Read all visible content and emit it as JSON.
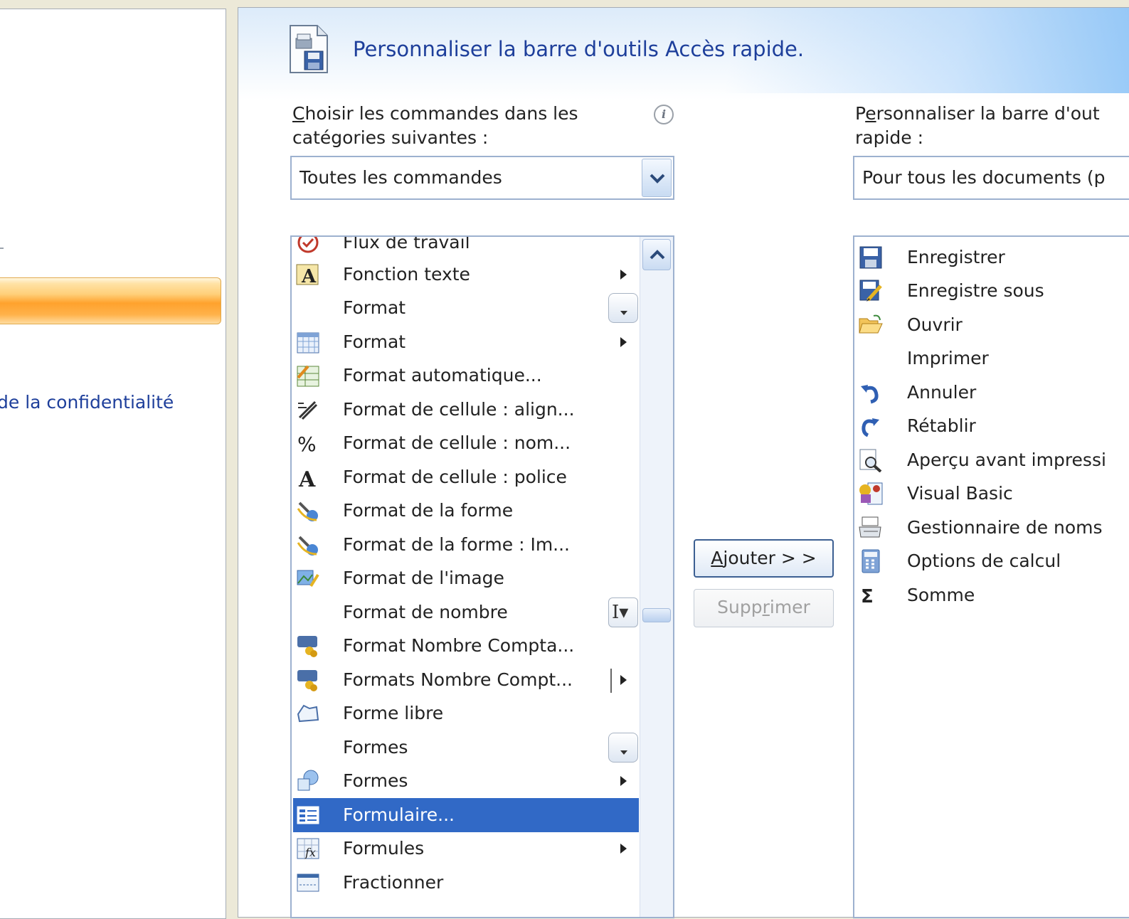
{
  "nav": {
    "privacy_link": "de la confidentialité"
  },
  "header": {
    "title": "Personnaliser la barre d'outils Accès rapide."
  },
  "commands": {
    "label_line1_first": "C",
    "label_line1_rest": "hoisir les commandes dans les",
    "label_line2": "catégories suivantes :",
    "selected": "Toutes les commandes",
    "items": [
      {
        "label": "Flux de travail",
        "icon": "workflow-icon"
      },
      {
        "label": "Fonction texte",
        "icon": "text-function-icon"
      },
      {
        "label": "Format",
        "icon": "none"
      },
      {
        "label": "Format",
        "icon": "calendar-format-icon"
      },
      {
        "label": "Format automatique...",
        "icon": "autoformat-icon"
      },
      {
        "label": "Format de cellule : align...",
        "icon": "align-icon"
      },
      {
        "label": "Format de cellule : nom...",
        "icon": "percent-icon"
      },
      {
        "label": "Format de cellule : police",
        "icon": "font-icon"
      },
      {
        "label": "Format de la forme",
        "icon": "shape-format-icon"
      },
      {
        "label": "Format de la forme : Im...",
        "icon": "shape-format-icon"
      },
      {
        "label": "Format de l'image",
        "icon": "picture-format-icon"
      },
      {
        "label": "Format de nombre",
        "icon": "none"
      },
      {
        "label": "Format Nombre Compta...",
        "icon": "accounting-icon"
      },
      {
        "label": "Formats Nombre Compt...",
        "icon": "accounting-icon"
      },
      {
        "label": "Forme libre",
        "icon": "freeform-icon"
      },
      {
        "label": "Formes",
        "icon": "none"
      },
      {
        "label": "Formes",
        "icon": "shapes-icon"
      },
      {
        "label": "Formulaire...",
        "icon": "form-icon"
      },
      {
        "label": "Formules",
        "icon": "formulas-icon"
      },
      {
        "label": "Fractionner",
        "icon": "split-icon"
      }
    ]
  },
  "buttons": {
    "add_first": "A",
    "add_rest": "jouter > >",
    "remove_before": "Supp",
    "remove_underlined": "r",
    "remove_after": "imer"
  },
  "toolbar": {
    "label_line1_first": "P",
    "label_line1_underlined": "e",
    "label_line1_rest": "rsonnaliser la barre d'out",
    "label_line2": "rapide :",
    "scope": "Pour tous les documents (p",
    "items": [
      {
        "label": "Enregistrer",
        "icon": "save-icon"
      },
      {
        "label": "Enregistre sous",
        "icon": "save-as-icon"
      },
      {
        "label": "Ouvrir",
        "icon": "open-folder-icon"
      },
      {
        "label": "Imprimer",
        "icon": "none"
      },
      {
        "label": "Annuler",
        "icon": "undo-icon"
      },
      {
        "label": "Rétablir",
        "icon": "redo-icon"
      },
      {
        "label": "Aperçu avant impressi",
        "icon": "print-preview-icon"
      },
      {
        "label": "Visual Basic",
        "icon": "visual-basic-icon"
      },
      {
        "label": "Gestionnaire de noms",
        "icon": "name-manager-icon"
      },
      {
        "label": "Options de calcul",
        "icon": "calculator-icon"
      },
      {
        "label": "Somme",
        "icon": "sum-icon"
      }
    ]
  },
  "colors": {
    "selection": "#3169c6",
    "accent_orange": "#ffa22d",
    "title_blue": "#1e3f9b"
  }
}
